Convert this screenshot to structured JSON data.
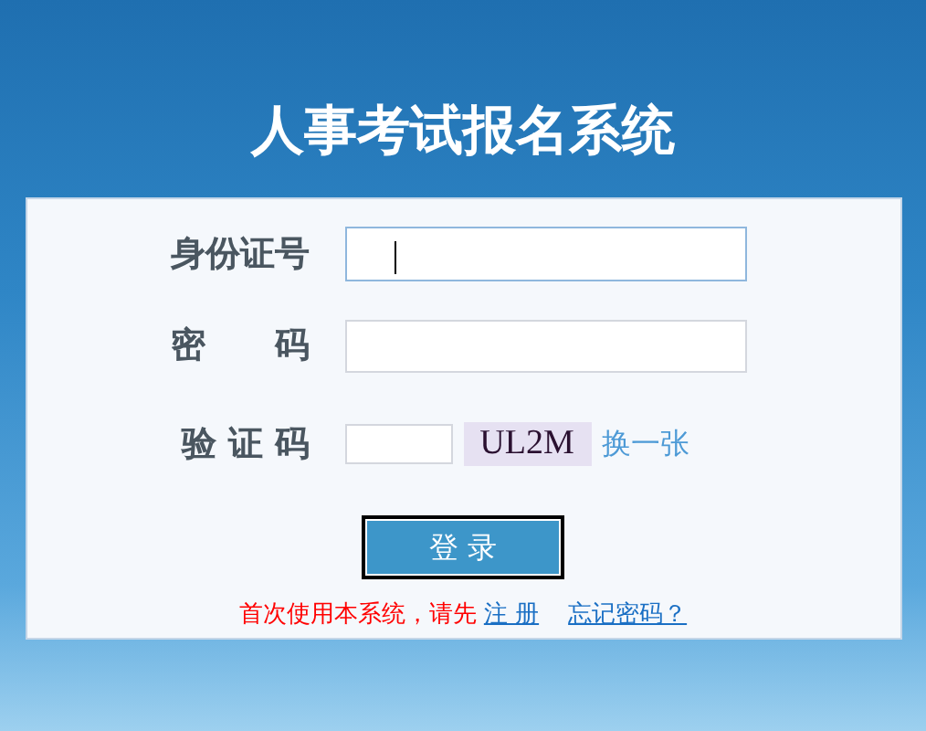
{
  "title": "人事考试报名系统",
  "fields": [
    {
      "kind": "text",
      "label": "身份证号",
      "focused": true
    },
    {
      "kind": "password",
      "label": "密　　码",
      "focused": false
    },
    {
      "kind": "captcha",
      "label": "验 证 码",
      "focused": false,
      "captcha": "UL2M",
      "refresh": "换一张"
    }
  ],
  "login_button": "登 录",
  "footer": {
    "note": "首次使用本系统，请先",
    "register": "注 册",
    "forgot": "忘记密码？"
  }
}
